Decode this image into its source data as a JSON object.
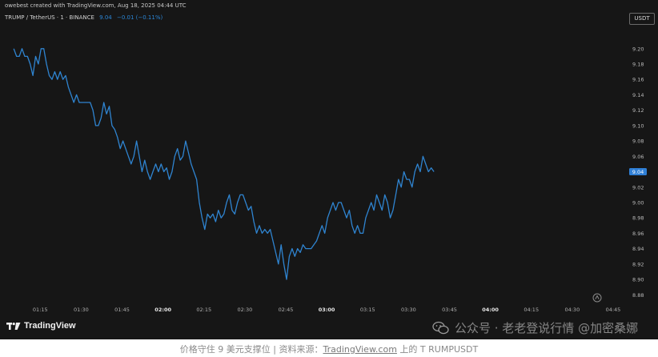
{
  "header": {
    "credit": "owebest created with TradingView.com, Aug 18, 2025 04:44 UTC",
    "symbol": "TRUMP / TetherUS · 1 · BINANCE",
    "last_value": "9.04",
    "change": "−0.01 (−0.11%)",
    "unit": "USDT"
  },
  "branding": {
    "name": "TradingView"
  },
  "watermark": {
    "text": "公众号 · 老老登说行情 @加密桑娜"
  },
  "caption": {
    "prefix": "价格守住 9 美元支撑位 | 资料来源：",
    "link": "TradingView.com",
    "suffix": " 上的 T RUMPUSDT"
  },
  "colors": {
    "line": "#2f84d0",
    "background": "#161616",
    "price_tag": "#2f7fd6"
  },
  "icons": {
    "logo": "tradingview-logo-icon",
    "settings": "chart-settings-icon",
    "wechat": "wechat-icon"
  },
  "chart_data": {
    "type": "line",
    "title": "",
    "xlabel": "",
    "ylabel": "",
    "x_ticks": [
      "01:15",
      "01:30",
      "01:45",
      "02:00",
      "02:15",
      "02:30",
      "02:45",
      "03:00",
      "03:15",
      "03:30",
      "03:45",
      "04:00",
      "04:15",
      "04:30",
      "04:45"
    ],
    "x_ticks_bold": [
      "02:00",
      "03:00",
      "04:00"
    ],
    "y_ticks": [
      "9.20",
      "9.18",
      "9.16",
      "9.14",
      "9.12",
      "9.10",
      "9.08",
      "9.06",
      "9.04",
      "9.02",
      "9.00",
      "8.98",
      "8.96",
      "8.94",
      "8.92",
      "8.90",
      "8.88"
    ],
    "ylim": [
      8.872,
      9.232
    ],
    "x_start_minutes": 65.3,
    "x_step_minutes": 1,
    "grid": false,
    "current_price": 9.04,
    "series": [
      {
        "name": "",
        "values": [
          9.2,
          9.19,
          9.19,
          9.2,
          9.19,
          9.19,
          9.18,
          9.165,
          9.19,
          9.18,
          9.2,
          9.2,
          9.18,
          9.165,
          9.16,
          9.17,
          9.16,
          9.17,
          9.16,
          9.165,
          9.15,
          9.14,
          9.13,
          9.14,
          9.13,
          9.13,
          9.13,
          9.13,
          9.13,
          9.12,
          9.1,
          9.1,
          9.11,
          9.13,
          9.115,
          9.125,
          9.1,
          9.095,
          9.085,
          9.07,
          9.08,
          9.07,
          9.06,
          9.05,
          9.06,
          9.08,
          9.06,
          9.04,
          9.055,
          9.04,
          9.03,
          9.04,
          9.05,
          9.04,
          9.05,
          9.04,
          9.045,
          9.03,
          9.04,
          9.06,
          9.07,
          9.055,
          9.06,
          9.08,
          9.065,
          9.05,
          9.04,
          9.03,
          9.0,
          8.98,
          8.965,
          8.985,
          8.98,
          8.985,
          8.975,
          8.99,
          8.98,
          8.985,
          9.0,
          9.01,
          8.99,
          8.985,
          9.0,
          9.01,
          9.01,
          9.0,
          8.99,
          8.995,
          8.975,
          8.96,
          8.97,
          8.96,
          8.965,
          8.96,
          8.965,
          8.95,
          8.935,
          8.92,
          8.945,
          8.92,
          8.9,
          8.93,
          8.94,
          8.93,
          8.94,
          8.935,
          8.945,
          8.94,
          8.94,
          8.94,
          8.945,
          8.95,
          8.96,
          8.97,
          8.96,
          8.98,
          8.99,
          9.0,
          8.99,
          9.0,
          9.0,
          8.99,
          8.98,
          8.99,
          8.97,
          8.96,
          8.97,
          8.96,
          8.96,
          8.98,
          8.99,
          9.0,
          8.99,
          9.01,
          9.0,
          8.99,
          9.01,
          9.0,
          8.98,
          8.99,
          9.01,
          9.03,
          9.02,
          9.04,
          9.03,
          9.03,
          9.02,
          9.04,
          9.05,
          9.04,
          9.06,
          9.05,
          9.04,
          9.045,
          9.04
        ]
      }
    ]
  }
}
